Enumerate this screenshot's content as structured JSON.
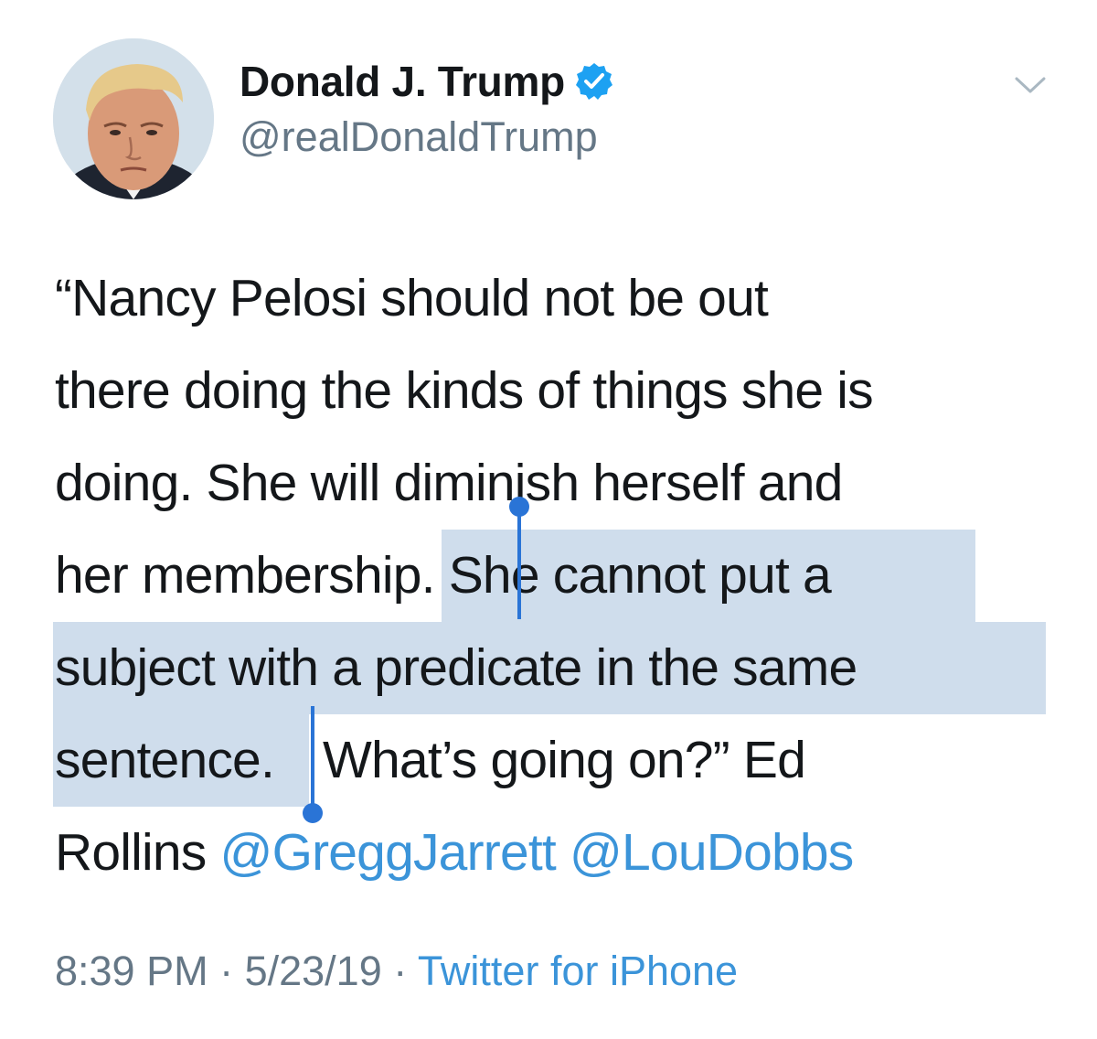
{
  "author": {
    "display_name": "Donald J. Trump",
    "handle": "@realDonaldTrump",
    "verified": true
  },
  "tweet": {
    "lines": [
      {
        "plain": "“Nancy Pelosi should not be out"
      },
      {
        "plain": "there doing the kinds of things she is"
      },
      {
        "plain": "doing. She will diminish herself and"
      },
      {
        "pre": "her membership. ",
        "selected": "She cannot put a"
      },
      {
        "selected": "subject with a predicate in the same"
      },
      {
        "selected": "sentence.",
        "post": " What’s going on?”  Ed"
      },
      {
        "text": "Rollins ",
        "mention1": "@GreggJarrett",
        "mention2": "@LouDobbs"
      }
    ]
  },
  "meta": {
    "time": "8:39 PM",
    "separator": " · ",
    "date": "5/23/19",
    "source": "Twitter for iPhone"
  },
  "colors": {
    "selection": "#cfddec",
    "link": "#3b94d9",
    "caret": "#2a74d6",
    "verified": "#1da1f2"
  }
}
